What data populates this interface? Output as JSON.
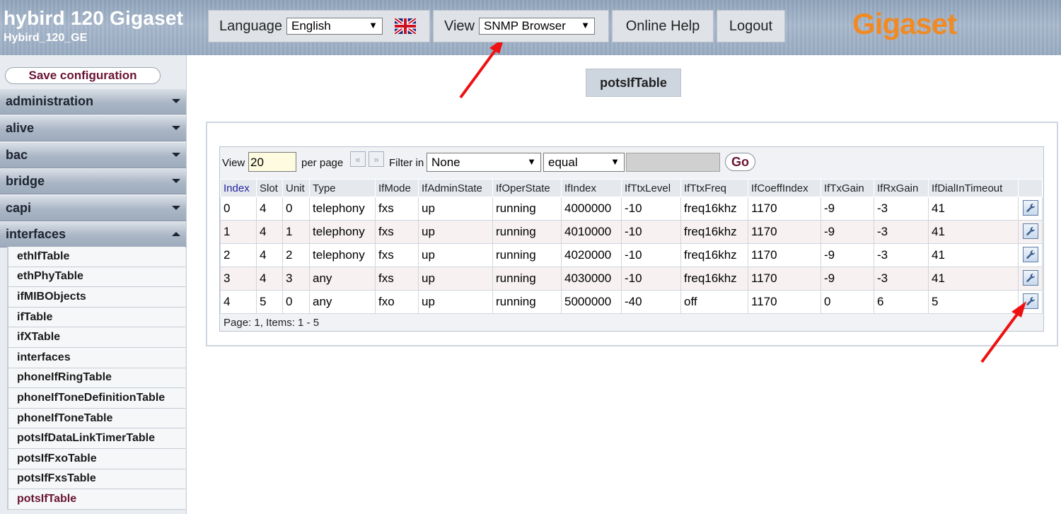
{
  "header": {
    "device_title": "hybird 120 Gigaset",
    "device_subtitle": "Hybird_120_GE",
    "language_label": "Language",
    "language_value": "English",
    "view_label": "View",
    "view_value": "SNMP Browser",
    "online_help": "Online Help",
    "logout": "Logout",
    "logo_text": "Gigaset"
  },
  "sidebar": {
    "save_button": "Save configuration",
    "groups": [
      "administration",
      "alive",
      "bac",
      "bridge",
      "capi",
      "interfaces"
    ],
    "items": [
      "ethIfTable",
      "ethPhyTable",
      "ifMIBObjects",
      "ifTable",
      "ifXTable",
      "interfaces",
      "phoneIfRingTable",
      "phoneIfToneDefinitionTable",
      "phoneIfToneTable",
      "potsIfDataLinkTimerTable",
      "potsIfFxoTable",
      "potsIfFxsTable",
      "potsIfTable"
    ],
    "active_item": "potsIfTable"
  },
  "main": {
    "title": "potsIfTable",
    "filter": {
      "view_label": "View",
      "view_value": "20",
      "per_page": "per page",
      "prev_glyph": "«",
      "next_glyph": "»",
      "filter_in": "Filter in",
      "field_value": "None",
      "op_value": "equal",
      "go": "Go"
    },
    "columns": [
      "Index",
      "Slot",
      "Unit",
      "Type",
      "IfMode",
      "IfAdminState",
      "IfOperState",
      "IfIndex",
      "IfTtxLevel",
      "IfTtxFreq",
      "IfCoeffIndex",
      "IfTxGain",
      "IfRxGain",
      "IfDialInTimeout"
    ],
    "rows": [
      [
        "0",
        "4",
        "0",
        "telephony",
        "fxs",
        "up",
        "running",
        "4000000",
        "-10",
        "freq16khz",
        "1170",
        "-9",
        "-3",
        "41"
      ],
      [
        "1",
        "4",
        "1",
        "telephony",
        "fxs",
        "up",
        "running",
        "4010000",
        "-10",
        "freq16khz",
        "1170",
        "-9",
        "-3",
        "41"
      ],
      [
        "2",
        "4",
        "2",
        "telephony",
        "fxs",
        "up",
        "running",
        "4020000",
        "-10",
        "freq16khz",
        "1170",
        "-9",
        "-3",
        "41"
      ],
      [
        "3",
        "4",
        "3",
        "any",
        "fxs",
        "up",
        "running",
        "4030000",
        "-10",
        "freq16khz",
        "1170",
        "-9",
        "-3",
        "41"
      ],
      [
        "4",
        "5",
        "0",
        "any",
        "fxo",
        "up",
        "running",
        "5000000",
        "-40",
        "off",
        "1170",
        "0",
        "6",
        "5"
      ]
    ],
    "page_info": "Page:  1, Items:  1 - 5"
  },
  "colors": {
    "accent": "#6a1433",
    "logo": "#f08a24",
    "annotation": "#ee1111"
  }
}
